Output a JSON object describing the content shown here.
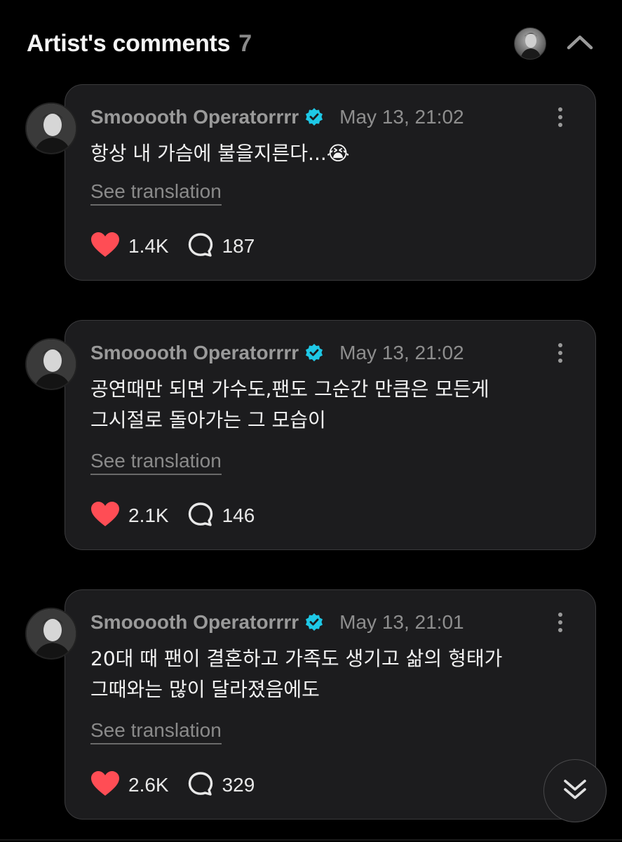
{
  "header": {
    "title": "Artist's comments",
    "count": "7"
  },
  "comments": [
    {
      "author": "Smooooth Operatorrrr",
      "timestamp": "May 13, 21:02",
      "text": "항상 내 가슴에 불을지른다...😭",
      "translate_label": "See translation",
      "likes": "1.4K",
      "replies": "187"
    },
    {
      "author": "Smooooth Operatorrrr",
      "timestamp": "May 13, 21:02",
      "text": "공연때만 되면 가수도,팬도 그순간 만큼은 모든게\n그시절로 돌아가는 그 모습이",
      "translate_label": "See translation",
      "likes": "2.1K",
      "replies": "146"
    },
    {
      "author": "Smooooth Operatorrrr",
      "timestamp": "May 13, 21:01",
      "text": "20대 때 팬이 결혼하고 가족도 생기고 삶의 형태가\n그때와는 많이 달라졌음에도",
      "translate_label": "See translation",
      "likes": "2.6K",
      "replies": "329"
    }
  ],
  "icons": {
    "verified": "verified-badge-icon",
    "like": "heart-icon",
    "reply": "speech-bubble-icon",
    "more": "more-vertical-icon",
    "collapse": "chevron-up-icon",
    "scroll": "double-chevron-down-icon"
  },
  "colors": {
    "background": "#000000",
    "card": "#1c1c1e",
    "verified": "#1ec8e6",
    "heart": "#ff4d55",
    "muted_text": "#8e8e8e"
  }
}
